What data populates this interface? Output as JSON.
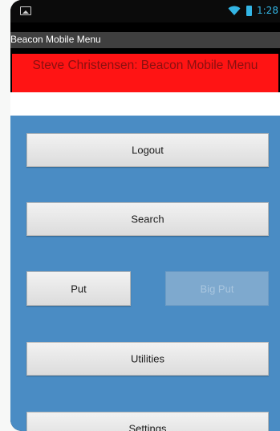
{
  "status_bar": {
    "time": "1:28",
    "icons": [
      "image-icon",
      "wifi-icon",
      "battery-icon"
    ],
    "accent_color": "#33b5e5"
  },
  "app": {
    "title": "Beacon Mobile Menu"
  },
  "header": {
    "text": "Steve Christensen: Beacon Mobile Menu",
    "background_color": "#ff1414",
    "text_color": "#8a1010"
  },
  "menu": {
    "background_color": "#4a8cc4",
    "logout_label": "Logout",
    "search_label": "Search",
    "put_label": "Put",
    "big_put_label": "Big Put",
    "big_put_enabled": false,
    "utilities_label": "Utilities",
    "settings_label": "Settings"
  }
}
